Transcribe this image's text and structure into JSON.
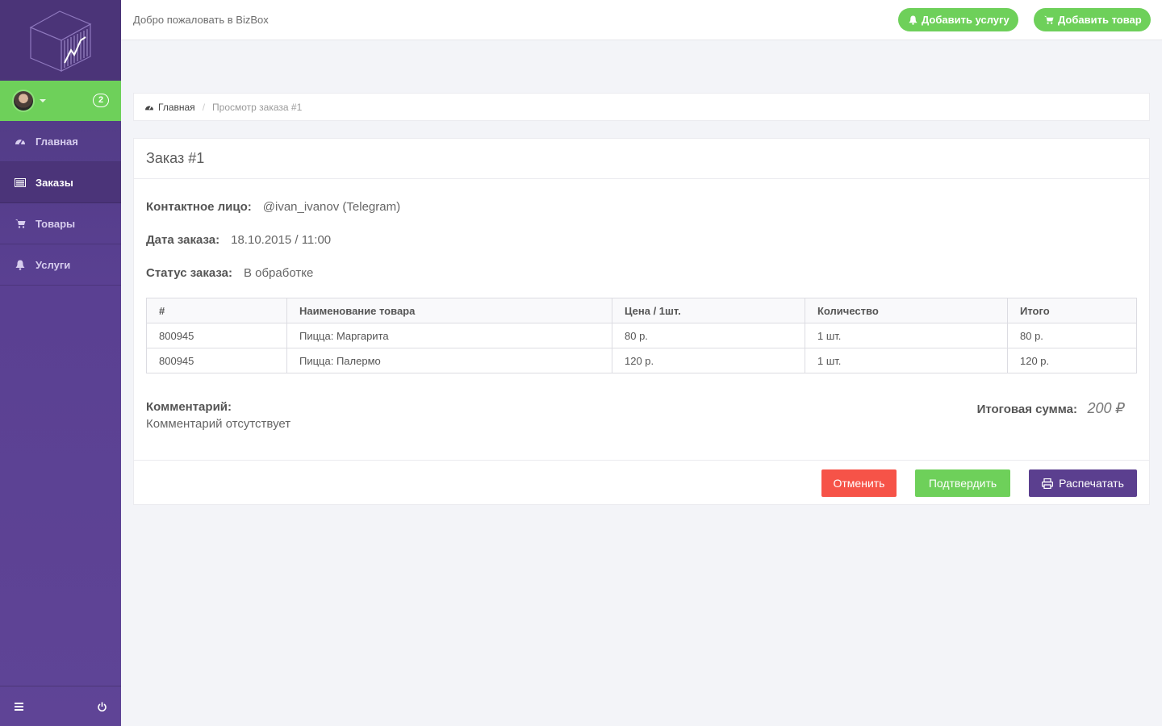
{
  "colors": {
    "sidebar": "#5a4092",
    "accent_green": "#6ed05a",
    "danger": "#f65348",
    "primary": "#5b3f8f"
  },
  "sidebar": {
    "user_badge": "2",
    "items": [
      {
        "label": "Главная",
        "icon": "dashboard-icon"
      },
      {
        "label": "Заказы",
        "icon": "list-icon",
        "active": true
      },
      {
        "label": "Товары",
        "icon": "cart-icon"
      },
      {
        "label": "Услуги",
        "icon": "bell-icon"
      }
    ],
    "footer": {
      "menu_icon": "hamburger-icon",
      "power_icon": "power-icon"
    }
  },
  "header": {
    "welcome": "Добро пожаловать в BizBox",
    "add_service": "Добавить услугу",
    "add_product": "Добавить товар"
  },
  "breadcrumb": {
    "home": "Главная",
    "current": "Просмотр заказа #1"
  },
  "order": {
    "title": "Заказ #1",
    "contact_label": "Контактное лицо:",
    "contact_value": "@ivan_ivanov (Telegram)",
    "date_label": "Дата заказа:",
    "date_value": "18.10.2015 / 11:00",
    "status_label": "Статус заказа:",
    "status_value": "В обработке",
    "table": {
      "headers": [
        "#",
        "Наименование товара",
        "Цена / 1шт.",
        "Количество",
        "Итого"
      ],
      "rows": [
        [
          "800945",
          "Пицца: Маргарита",
          "80 р.",
          "1 шт.",
          "80 р."
        ],
        [
          "800945",
          "Пицца: Палермо",
          "120 р.",
          "1 шт.",
          "120 р."
        ]
      ]
    },
    "comment_label": "Комментарий:",
    "comment_value": "Комментарий отсутствует",
    "total_label": "Итоговая сумма:",
    "total_value": "200 ₽",
    "actions": {
      "cancel": "Отменить",
      "confirm": "Подтвердить",
      "print": "Распечатать"
    }
  }
}
